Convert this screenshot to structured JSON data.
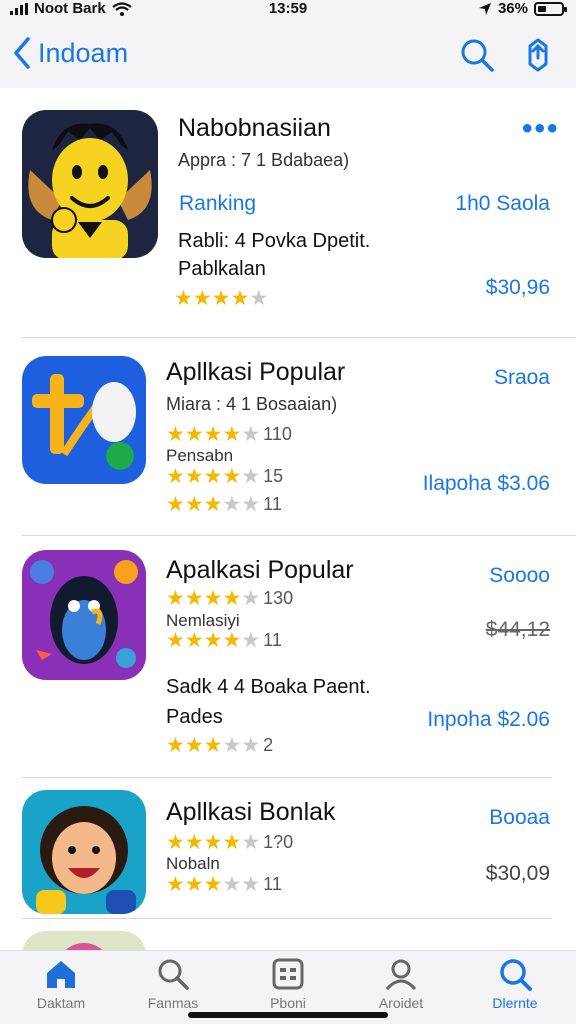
{
  "status_bar": {
    "carrier": "Noot Bark",
    "time": "13:59",
    "battery": "36%",
    "battery_level": 0.36
  },
  "nav": {
    "back_label": "Indoam",
    "search_icon": "search-icon",
    "share_icon": "share-icon"
  },
  "featured": {
    "title": "Nabobnasiian",
    "subtitle": "Appra : 7 1 Bdabaea)",
    "ranking_label": "Ranking",
    "ranking_value": "1h0 Saola",
    "desc_line1": "Rabli: 4 Povka Dpetit.",
    "desc_line2": "Pablkalan",
    "rating": 4,
    "price": "$30,96",
    "more_icon": "more-dots-icon"
  },
  "apps": [
    {
      "title": "Apllkasi Popular",
      "subtitle": "Miara : 4 1 Bosaaian)",
      "label": "Pensabn",
      "ratings": [
        {
          "stars": 4,
          "count": "110"
        },
        {
          "stars": 4,
          "count": "15"
        },
        {
          "stars": 3,
          "count": "11"
        }
      ],
      "link": "Sraoa",
      "price": "Ilapoha $3.06"
    },
    {
      "title": "Apalkasi Popular",
      "label": "Nemlasiyi",
      "desc_line1": "Sadk 4 4 Boaka Paent.",
      "desc_line2": "Pades",
      "ratings": [
        {
          "stars": 4,
          "count": "130"
        },
        {
          "stars": 4,
          "count": "11"
        },
        {
          "stars": 3,
          "count": "2"
        }
      ],
      "link": "Soooo",
      "price_old": "$44,12",
      "price": "Inpoha $2.06"
    },
    {
      "title": "Apllkasi Bonlak",
      "label": "Nobaln",
      "ratings": [
        {
          "stars": 4,
          "count": "1?0"
        },
        {
          "stars": 3,
          "count": "11"
        }
      ],
      "link": "Booaa",
      "price": "$30,09"
    }
  ],
  "tabs": [
    {
      "label": "Daktam",
      "icon": "home-icon"
    },
    {
      "label": "Fanmas",
      "icon": "search-icon"
    },
    {
      "label": "Pboni",
      "icon": "apps-grid-icon"
    },
    {
      "label": "Aroidet",
      "icon": "person-icon"
    },
    {
      "label": "Dlernte",
      "icon": "search-icon",
      "active": true
    }
  ],
  "colors": {
    "accent": "#1877e8",
    "star": "#f5b800",
    "bar_bg": "#f4f4f6"
  }
}
